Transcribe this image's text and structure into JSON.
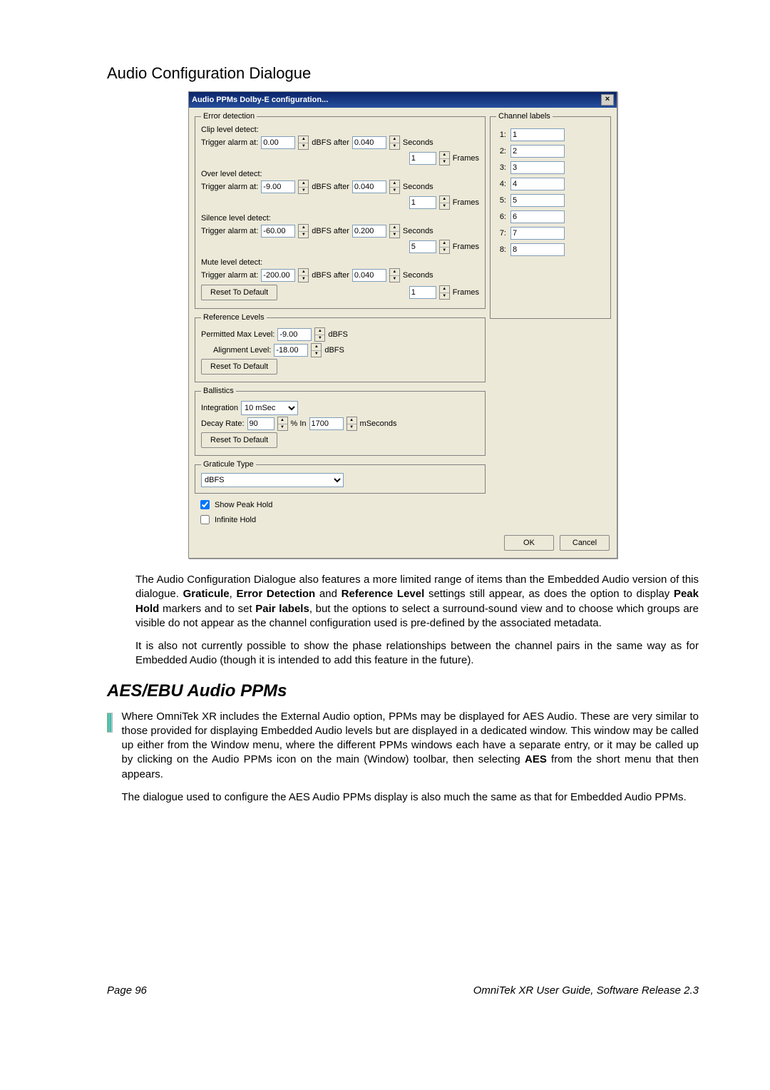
{
  "section_title": "Audio Configuration Dialogue",
  "dialog": {
    "title": "Audio PPMs Dolby-E configuration...",
    "error_detection": {
      "legend": "Error detection",
      "clip_label": "Clip level detect:",
      "over_label": "Over level detect:",
      "silence_label": "Silence level detect:",
      "mute_label": "Mute level detect:",
      "trigger_label": "Trigger alarm at:",
      "dbfs_after": "dBFS  after",
      "seconds": "Seconds",
      "frames": "Frames",
      "clip_val": "0.00",
      "clip_after": "0.040",
      "clip_frames": "1",
      "over_val": "-9.00",
      "over_after": "0.040",
      "over_frames": "1",
      "silence_val": "-60.00",
      "silence_after": "0.200",
      "silence_frames": "5",
      "mute_val": "-200.00",
      "mute_after": "0.040",
      "mute_frames": "1",
      "reset": "Reset To Default"
    },
    "channel_labels": {
      "legend": "Channel labels",
      "items": [
        {
          "n": "1:",
          "v": "1"
        },
        {
          "n": "2:",
          "v": "2"
        },
        {
          "n": "3:",
          "v": "3"
        },
        {
          "n": "4:",
          "v": "4"
        },
        {
          "n": "5:",
          "v": "5"
        },
        {
          "n": "6:",
          "v": "6"
        },
        {
          "n": "7:",
          "v": "7"
        },
        {
          "n": "8:",
          "v": "8"
        }
      ]
    },
    "reference": {
      "legend": "Reference Levels",
      "permitted_label": "Permitted Max Level:",
      "permitted_val": "-9.00",
      "alignment_label": "Alignment Level:",
      "alignment_val": "-18.00",
      "dbfs": "dBFS",
      "reset": "Reset To Default"
    },
    "ballistics": {
      "legend": "Ballistics",
      "integration_label": "Integration",
      "integration_val": "10 mSec",
      "decay_label": "Decay Rate:",
      "decay_val": "90",
      "pct_in": "% In",
      "decay_ms": "1700",
      "mseconds": "mSeconds",
      "reset": "Reset To Default"
    },
    "graticule": {
      "legend": "Graticule Type",
      "value": "dBFS"
    },
    "show_peak": "Show Peak Hold",
    "infinite": "Infinite Hold",
    "ok": "OK",
    "cancel": "Cancel"
  },
  "para1_a": "The Audio Configuration Dialogue also features a more limited range of items than the Embedded Audio version of this dialogue. ",
  "para1_b": "Graticule",
  "para1_c": ", ",
  "para1_d": "Error Detection",
  "para1_e": " and ",
  "para1_f": "Reference Level",
  "para1_g": " settings still appear, as does the option to display ",
  "para1_h": "Peak Hold",
  "para1_i": " markers and to set ",
  "para1_j": "Pair labels",
  "para1_k": ", but the options to select a surround-sound view and to choose which groups are visible do not appear as the channel configuration used is pre-defined by the associated metadata.",
  "para2": "It is also not currently possible to show the phase relationships between the channel pairs in the same way as for Embedded Audio (though it is intended to add this feature in the future).",
  "heading2": "AES/EBU Audio PPMs",
  "para3_a": "Where OmniTek XR includes the External Audio option, PPMs may be displayed for AES Audio. These are very similar to those provided for displaying Embedded Audio levels but are displayed in a dedicated window. This window may be called up either from the Window menu, where the different PPMs windows each have a separate entry, or it may be called up by clicking on the Audio PPMs icon on the main (Window) toolbar, then selecting ",
  "para3_b": "AES",
  "para3_c": " from the short menu that then appears.",
  "para4": "The dialogue used to configure the AES Audio PPMs display is also much the same as that for Embedded Audio PPMs.",
  "footer_left": "Page 96",
  "footer_right": "OmniTek XR User Guide, Software Release 2.3"
}
